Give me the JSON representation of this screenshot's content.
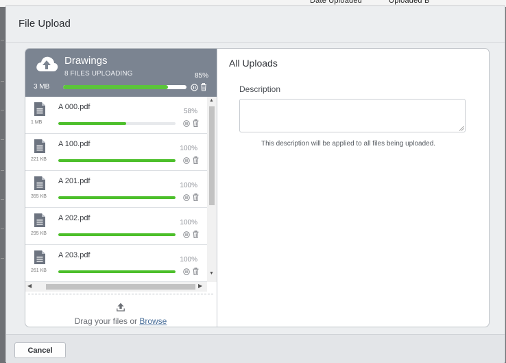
{
  "dialog": {
    "title": "File Upload"
  },
  "group": {
    "name": "Drawings",
    "status": "8 FILES UPLOADING",
    "percent_label": "85%",
    "progress": 0.85,
    "size": "3 MB"
  },
  "files": [
    {
      "name": "A 000.pdf",
      "size": "1 MB",
      "percent_label": "58%",
      "progress": 0.58
    },
    {
      "name": "A 100.pdf",
      "size": "221 KB",
      "percent_label": "100%",
      "progress": 1.0
    },
    {
      "name": "A 201.pdf",
      "size": "355 KB",
      "percent_label": "100%",
      "progress": 1.0
    },
    {
      "name": "A 202.pdf",
      "size": "295 KB",
      "percent_label": "100%",
      "progress": 1.0
    },
    {
      "name": "A 203.pdf",
      "size": "261 KB",
      "percent_label": "100%",
      "progress": 1.0
    }
  ],
  "dropzone": {
    "text": "Drag your files or",
    "link": "Browse"
  },
  "right": {
    "title": "All Uploads",
    "description_label": "Description",
    "description_value": "",
    "hint": "This description will be applied to all files being uploaded."
  },
  "footer": {
    "cancel_label": "Cancel"
  },
  "colors": {
    "progress": "#4cbf2a",
    "header_bg": "#7b8491"
  },
  "icons": [
    "cloud-upload-icon",
    "document-icon",
    "pause-icon",
    "trash-icon",
    "upload-icon"
  ]
}
